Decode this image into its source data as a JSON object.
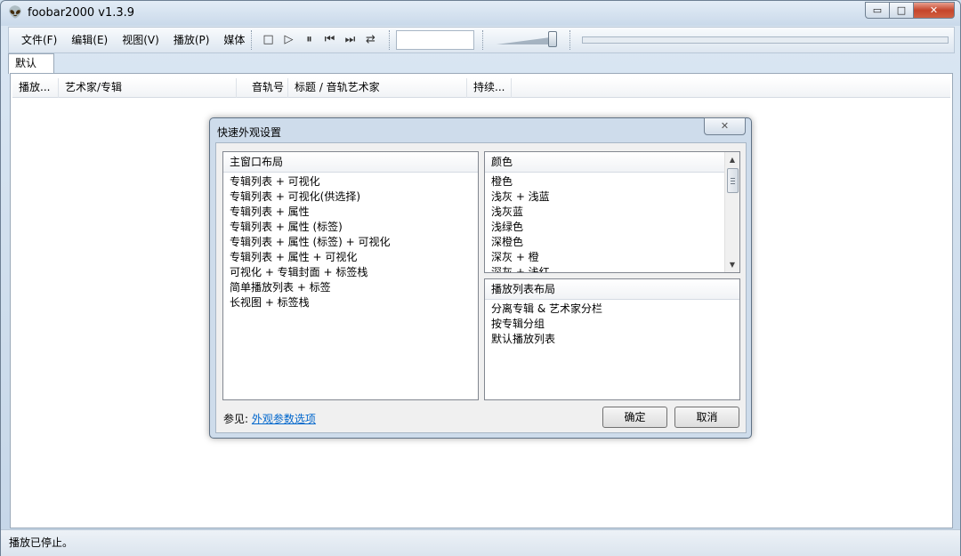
{
  "window": {
    "title": "foobar2000 v1.3.9",
    "app_icon": "foobar-alien-icon",
    "minimize_glyph": "▭",
    "maximize_glyph": "□",
    "close_glyph": "✕"
  },
  "menu": {
    "items": [
      "文件(F)",
      "编辑(E)",
      "视图(V)",
      "播放(P)",
      "媒体"
    ]
  },
  "controls": {
    "stop": "□",
    "play": "▷",
    "pause": "⏸",
    "prev": "⏮",
    "next": "⏭",
    "random": "⇄"
  },
  "tabs": [
    "默认"
  ],
  "playlist": {
    "columns": [
      "播放...",
      "艺术家/专辑",
      "音轨号",
      "标题 / 音轨艺术家",
      "持续..."
    ]
  },
  "status": {
    "text": "播放已停止。"
  },
  "dialog": {
    "title": "快速外观设置",
    "close_glyph": "✕",
    "main_layout": {
      "header": "主窗口布局",
      "items": [
        "专辑列表 + 可视化",
        "专辑列表 + 可视化(供选择)",
        "专辑列表 + 属性",
        "专辑列表 + 属性 (标签)",
        "专辑列表 + 属性 (标签) + 可视化",
        "专辑列表 + 属性 + 可视化",
        "可视化 + 专辑封面 + 标签栈",
        "简单播放列表 + 标签",
        "长视图 + 标签栈"
      ]
    },
    "colors": {
      "header": "颜色",
      "items": [
        "橙色",
        "浅灰 + 浅蓝",
        "浅灰蓝",
        "浅绿色",
        "深橙色",
        "深灰 + 橙",
        "深灰 + 浅红"
      ]
    },
    "playlist_layout": {
      "header": "播放列表布局",
      "items": [
        "分离专辑 & 艺术家分栏",
        "按专辑分组",
        "默认播放列表"
      ]
    },
    "see_also_label": "参见:",
    "see_also_link": "外观参数选项",
    "ok": "确定",
    "cancel": "取消"
  }
}
